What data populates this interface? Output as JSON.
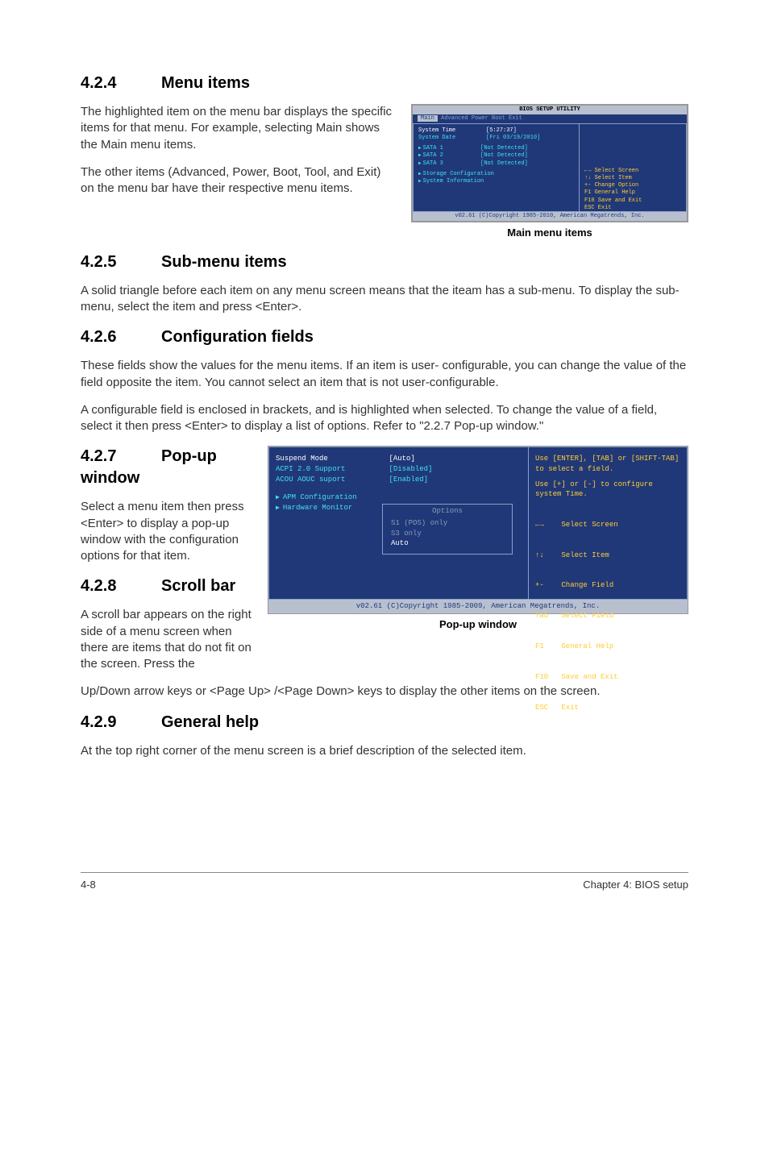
{
  "s424": {
    "num": "4.2.4",
    "title": "Menu items",
    "p1": "The highlighted item on the menu bar displays the specific items for that menu. For example, selecting Main shows the Main menu items.",
    "p2": "The other items (Advanced, Power, Boot, Tool, and Exit) on the menu bar have their respective menu items."
  },
  "s425": {
    "num": "4.2.5",
    "title": "Sub-menu items",
    "p1": "A solid triangle before each item on any menu screen means that the iteam has a sub-menu. To display the sub-menu, select the item and press <Enter>."
  },
  "s426": {
    "num": "4.2.6",
    "title": "Configuration fields",
    "p1": "These fields show the values for the menu items. If an item is user- configurable, you can change the value of the field opposite the item. You cannot select an item that is not user-configurable.",
    "p2": "A configurable field is enclosed in brackets, and is highlighted when selected. To change the value of a field, select it then press <Enter> to display a list of options. Refer to \"2.2.7 Pop-up window.\""
  },
  "s427": {
    "num": "4.2.7",
    "title": "Pop-up window",
    "p1": "Select a menu item then press <Enter> to display a pop-up window with the configuration options for that item."
  },
  "s428": {
    "num": "4.2.8",
    "title": "Scroll bar",
    "p1": "A scroll bar appears on the right side of a menu screen when there are items that do not fit on the screen. Press the",
    "p2": "Up/Down arrow keys or <Page Up> /<Page Down> keys to display the other items on the screen."
  },
  "s429": {
    "num": "4.2.9",
    "title": "General help",
    "p1": "At the top right corner of the menu screen is a brief description of the selected item."
  },
  "bios1": {
    "topbar": "BIOS SETUP UTILITY",
    "menubar_sel": "Main",
    "menubar_rest": "  Advanced   Power   Boot   Exit",
    "r1": "System Time         [5:27:37]",
    "r2": "System Date         [Fri 03/19/2010]",
    "s1": "SATA 1           [Not Detected]",
    "s2": "SATA 2           [Not Detected]",
    "s3": "SATA 3           [Not Detected]",
    "sc": "Storage Configuration",
    "si": "System Information",
    "nav1": "←→  Select Screen",
    "nav2": "↑↓  Select Item",
    "nav3": "+-  Change Option",
    "nav4": "F1  General Help",
    "nav5": "F10 Save and Exit",
    "nav6": "ESC Exit",
    "footer": "v02.61 (C)Copyright 1985-2010, American Megatrends, Inc.",
    "caption": "Main menu items"
  },
  "bios2": {
    "r1l": "Suspend Mode",
    "r1r": "[Auto]",
    "r2l": "ACPI 2.0 Support",
    "r2r": "[Disabled]",
    "r3l": "ACOU AOUC suport",
    "r3r": "[Enabled]",
    "r4": "APM Configuration",
    "r5": "Hardware Monitor",
    "popup_title": "Options",
    "popup_o1": "S1 (POS) only",
    "popup_o2": "S3 only",
    "popup_o3": "Auto",
    "help1": "Use [ENTER], [TAB] or [SHIFT-TAB] to select a field.",
    "help2": "Use [+] or [-] to configure system Time.",
    "nav1": "←→    Select Screen",
    "nav2": "↑↓    Select Item",
    "nav3": "+-    Change Field",
    "nav4": "Tab   Select Field",
    "nav5": "F1    General Help",
    "nav6": "F10   Save and Exit",
    "nav7": "ESC   Exit",
    "footer": "v02.61 (C)Copyright 1985-2009, American Megatrends, Inc.",
    "caption": "Pop-up window"
  },
  "footer": {
    "left": "4-8",
    "right": "Chapter 4: BIOS setup"
  }
}
